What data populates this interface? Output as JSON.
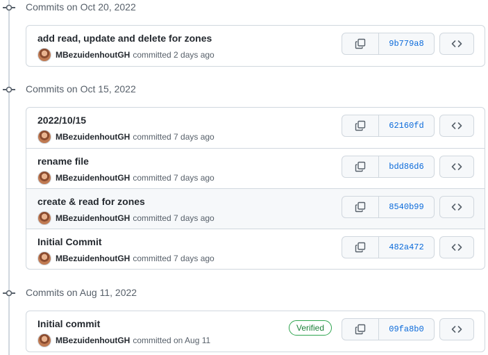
{
  "groups": [
    {
      "title": "Commits on Oct 20, 2022",
      "commits": [
        {
          "message": "add read, update and delete for zones",
          "author": "MBezuidenhoutGH",
          "time": "committed 2 days ago",
          "sha": "9b779a8",
          "verified": ""
        }
      ]
    },
    {
      "title": "Commits on Oct 15, 2022",
      "commits": [
        {
          "message": "2022/10/15",
          "author": "MBezuidenhoutGH",
          "time": "committed 7 days ago",
          "sha": "62160fd",
          "verified": ""
        },
        {
          "message": "rename file",
          "author": "MBezuidenhoutGH",
          "time": "committed 7 days ago",
          "sha": "bdd86d6",
          "verified": ""
        },
        {
          "message": "create & read for zones",
          "author": "MBezuidenhoutGH",
          "time": "committed 7 days ago",
          "sha": "8540b99",
          "verified": ""
        },
        {
          "message": "Initial Commit",
          "author": "MBezuidenhoutGH",
          "time": "committed 7 days ago",
          "sha": "482a472",
          "verified": ""
        }
      ]
    },
    {
      "title": "Commits on Aug 11, 2022",
      "commits": [
        {
          "message": "Initial commit",
          "author": "MBezuidenhoutGH",
          "time": "committed on Aug 11",
          "sha": "09fa8b0",
          "verified": "Verified"
        }
      ]
    }
  ],
  "icons": {
    "timeline": "git-commit-icon",
    "copy": "copy-icon",
    "browse": "code-icon",
    "avatar": "avatar"
  },
  "colors": {
    "link": "#0969da",
    "border": "#d0d7de",
    "verified": "#1a7f37",
    "highlight": "#f6f8fa"
  }
}
